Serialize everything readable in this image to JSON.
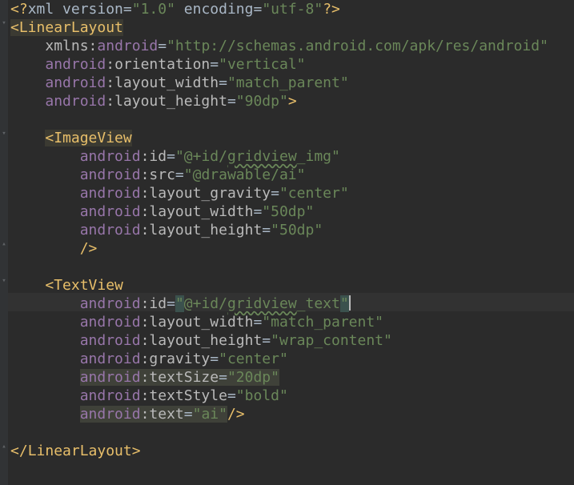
{
  "editor": {
    "lines": [
      {
        "decl_open": "<?",
        "decl_name": "xml",
        "v_attr": " version",
        "v_eq": "=",
        "v_val": "\"1.0\"",
        "e_attr": " encoding",
        "e_eq": "=",
        "e_val": "\"utf-8\"",
        "decl_close": "?>"
      },
      {
        "open": "<",
        "tag": "LinearLayout"
      },
      {
        "prefix": "xmlns",
        "colon": ":",
        "ns": "android",
        "eq": "=",
        "val": "\"http://schemas.android.com/apk/res/android\""
      },
      {
        "ns": "android",
        "colon": ":",
        "attr": "orientation",
        "eq": "=",
        "val": "\"vertical\""
      },
      {
        "ns": "android",
        "colon": ":",
        "attr": "layout_width",
        "eq": "=",
        "val": "\"match_parent\""
      },
      {
        "ns": "android",
        "colon": ":",
        "attr": "layout_height",
        "eq": "=",
        "val": "\"90dp\"",
        "close": ">"
      },
      {},
      {
        "open": "<",
        "tag": "ImageView"
      },
      {
        "ns": "android",
        "colon": ":",
        "attr": "id",
        "eq": "=",
        "val_a": "\"@+id/",
        "val_b": "gridview",
        "val_c": "_img\""
      },
      {
        "ns": "android",
        "colon": ":",
        "attr": "src",
        "eq": "=",
        "val": "\"@drawable/ai\""
      },
      {
        "ns": "android",
        "colon": ":",
        "attr": "layout_gravity",
        "eq": "=",
        "val": "\"center\""
      },
      {
        "ns": "android",
        "colon": ":",
        "attr": "layout_width",
        "eq": "=",
        "val": "\"50dp\""
      },
      {
        "ns": "android",
        "colon": ":",
        "attr": "layout_height",
        "eq": "=",
        "val": "\"50dp\""
      },
      {
        "close": "/>"
      },
      {},
      {
        "open": "<",
        "tag": "TextView"
      },
      {
        "ns": "android",
        "colon": ":",
        "attr": "id",
        "eq": "=",
        "q_open": "\"",
        "val_a": "@+id/",
        "val_b": "gridview",
        "val_c": "_text",
        "q_close": "\""
      },
      {
        "ns": "android",
        "colon": ":",
        "attr": "layout_width",
        "eq": "=",
        "val": "\"match_parent\""
      },
      {
        "ns": "android",
        "colon": ":",
        "attr": "layout_height",
        "eq": "=",
        "val": "\"wrap_content\""
      },
      {
        "ns": "android",
        "colon": ":",
        "attr": "gravity",
        "eq": "=",
        "val": "\"center\""
      },
      {
        "ns": "android",
        "colon": ":",
        "attr": "textSize",
        "eq": "=",
        "val": "\"20dp\""
      },
      {
        "ns": "android",
        "colon": ":",
        "attr": "textStyle",
        "eq": "=",
        "val": "\"bold\""
      },
      {
        "ns": "android",
        "colon": ":",
        "attr": "text",
        "eq": "=",
        "val": "\"ai\"",
        "close": "/>"
      },
      {},
      {
        "close_open": "</",
        "tag": "LinearLayout",
        "close": ">"
      }
    ],
    "fold_markers": [
      "minus",
      "minus",
      "minus",
      "end",
      "minus",
      "end",
      "end"
    ]
  }
}
